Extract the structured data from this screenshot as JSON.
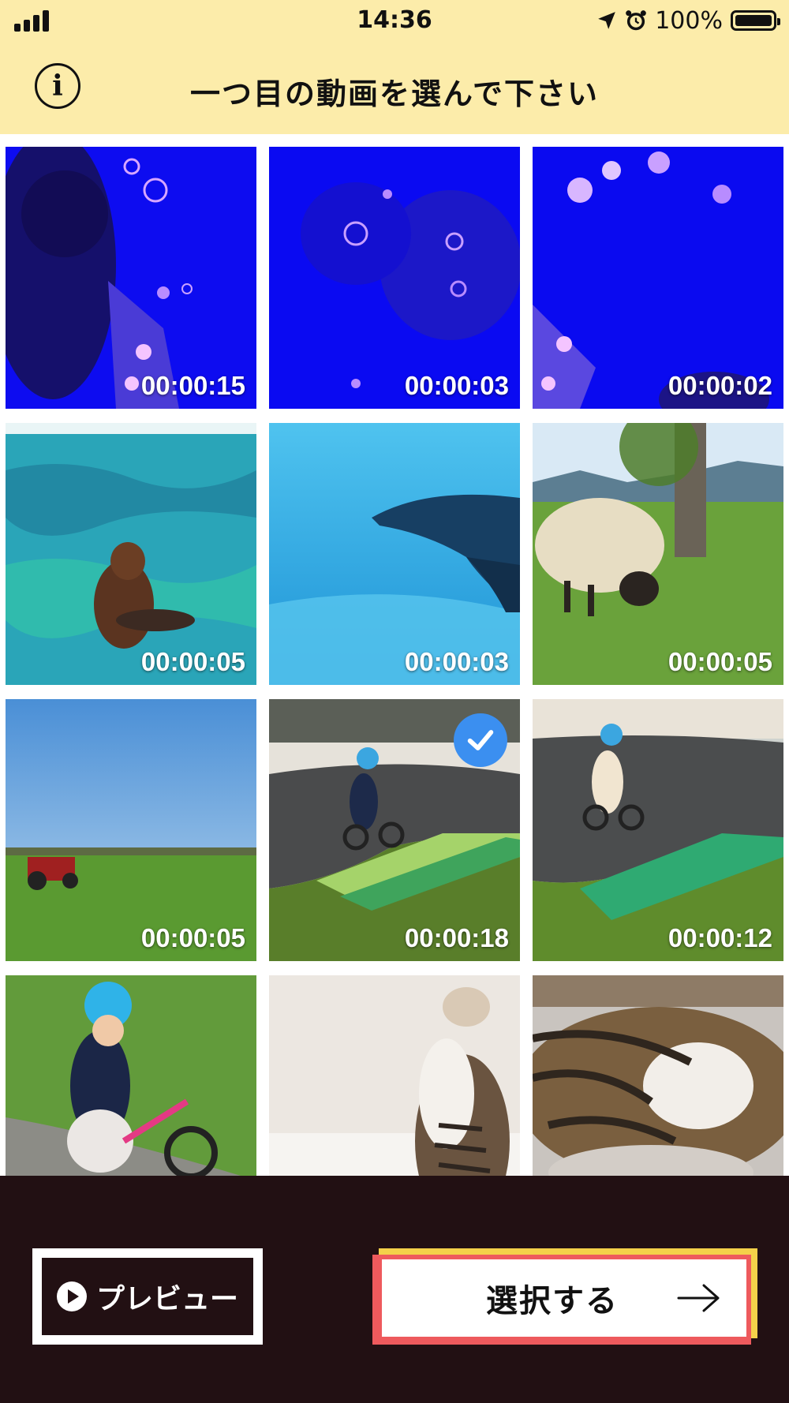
{
  "status_bar": {
    "time": "14:36",
    "battery": "100%"
  },
  "header": {
    "title": "一つ目の動画を選んで下さい",
    "info_label": "i"
  },
  "videos": [
    {
      "duration": "00:00:15",
      "scene": "jellyfish-child",
      "selected": false
    },
    {
      "duration": "00:00:03",
      "scene": "jellyfish",
      "selected": false
    },
    {
      "duration": "00:00:02",
      "scene": "jellyfish-corner",
      "selected": false
    },
    {
      "duration": "00:00:05",
      "scene": "sea-lion",
      "selected": false
    },
    {
      "duration": "00:00:03",
      "scene": "dolphin",
      "selected": false
    },
    {
      "duration": "00:00:05",
      "scene": "sheep",
      "selected": false
    },
    {
      "duration": "00:00:05",
      "scene": "tractor-field",
      "selected": false
    },
    {
      "duration": "00:00:18",
      "scene": "pump-track",
      "selected": true
    },
    {
      "duration": "00:00:12",
      "scene": "pump-track-2",
      "selected": false
    },
    {
      "duration": "",
      "scene": "kid-bike",
      "selected": false
    },
    {
      "duration": "",
      "scene": "cat-looking-up",
      "selected": false
    },
    {
      "duration": "",
      "scene": "cat-sleeping",
      "selected": false
    }
  ],
  "footer": {
    "preview_label": "プレビュー",
    "select_label": "選択する"
  },
  "colors": {
    "header_bg": "#fcecaa",
    "footer_bg": "#221013",
    "accent_yellow": "#f4d14a",
    "accent_red": "#ee5a5d",
    "check_blue": "#3b8ff0"
  },
  "icons": {
    "info": "info-icon",
    "check": "checkmark-icon",
    "play": "play-icon",
    "arrow": "arrow-right-icon"
  }
}
